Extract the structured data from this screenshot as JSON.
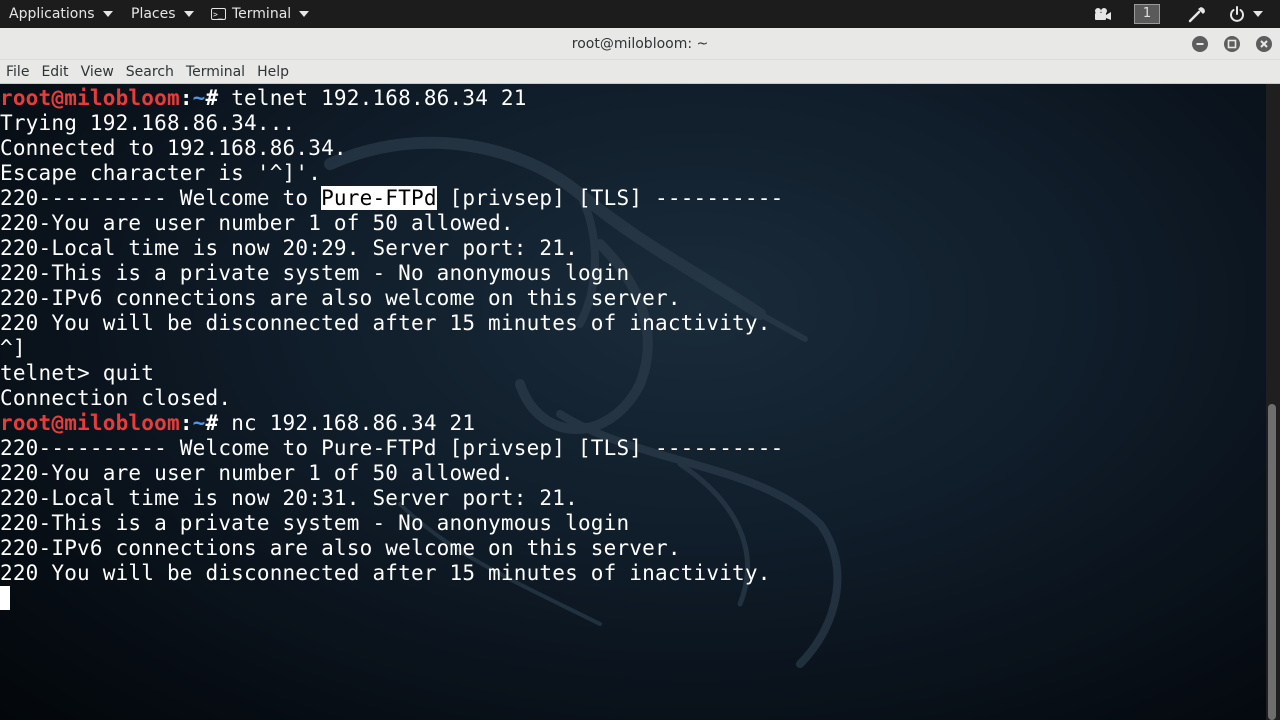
{
  "topbar": {
    "applications": "Applications",
    "places": "Places",
    "terminal": "Terminal",
    "workspace": "1"
  },
  "window": {
    "title": "root@milobloom: ~"
  },
  "menubar": [
    "File",
    "Edit",
    "View",
    "Search",
    "Terminal",
    "Help"
  ],
  "terminal": {
    "prompt_user": "root@milobloom",
    "prompt_sep": ":",
    "prompt_path": "~",
    "prompt_end": "# ",
    "cmd1": "telnet 192.168.86.34 21",
    "out1": [
      "Trying 192.168.86.34...",
      "Connected to 192.168.86.34.",
      "Escape character is '^]'."
    ],
    "banner1_pre": "220---------- Welcome to ",
    "banner1_hl": "Pure-FTPd",
    "banner1_post": " [privsep] [TLS] ----------",
    "out2": [
      "220-You are user number 1 of 50 allowed.",
      "220-Local time is now 20:29. Server port: 21.",
      "220-This is a private system - No anonymous login",
      "220-IPv6 connections are also welcome on this server.",
      "220 You will be disconnected after 15 minutes of inactivity.",
      "^]",
      "telnet> quit",
      "Connection closed."
    ],
    "cmd2": "nc 192.168.86.34 21",
    "out3": [
      "220---------- Welcome to Pure-FTPd [privsep] [TLS] ----------",
      "220-You are user number 1 of 50 allowed.",
      "220-Local time is now 20:31. Server port: 21.",
      "220-This is a private system - No anonymous login",
      "220-IPv6 connections are also welcome on this server.",
      "220 You will be disconnected after 15 minutes of inactivity."
    ]
  },
  "colors": {
    "prompt_user": "#e63c3c",
    "prompt_path": "#5294e2",
    "text": "#ffffff",
    "topbar_bg": "#1c1c1c",
    "chrome_bg": "#e8e8e7"
  },
  "icons": [
    "terminal-icon",
    "video-camera-icon",
    "color-picker-icon",
    "power-icon",
    "chevron-down-icon",
    "minimize-icon",
    "maximize-icon",
    "close-icon"
  ]
}
